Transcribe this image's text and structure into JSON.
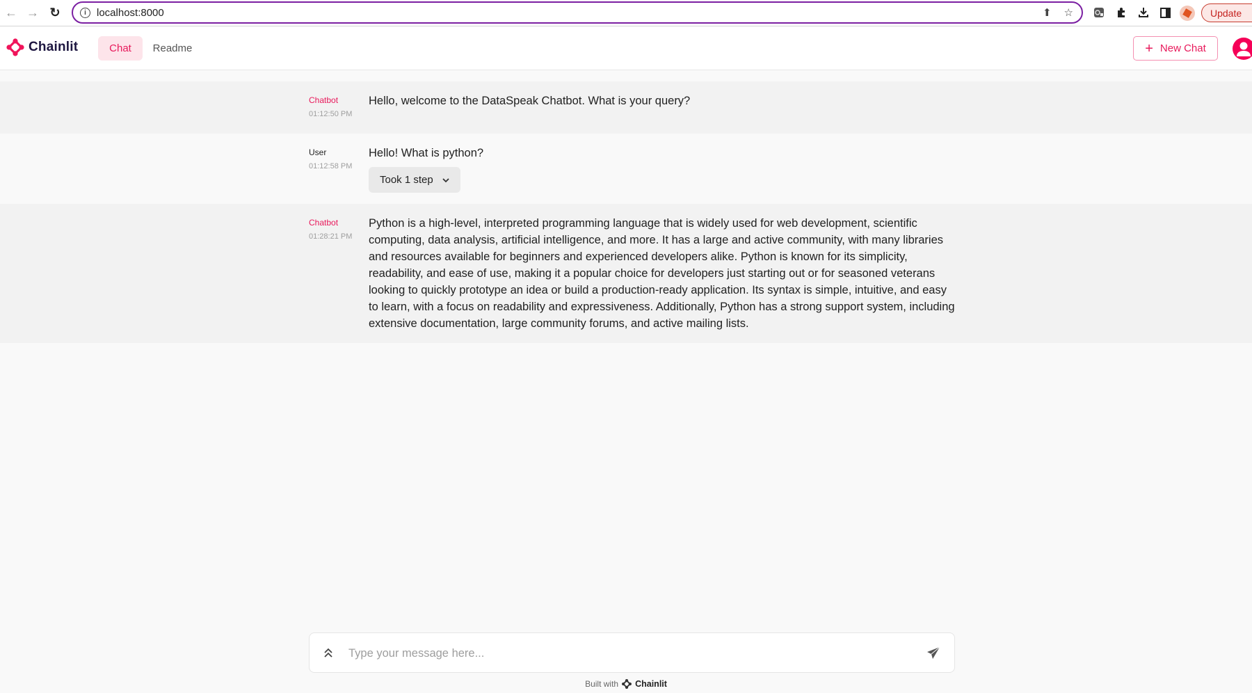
{
  "browser": {
    "url": "localhost:8000",
    "update_label": "Update",
    "icons": [
      "back-arrow-icon",
      "forward-arrow-icon",
      "reload-icon",
      "site-info-icon",
      "share-icon",
      "bookmark-star-icon",
      "extension-icon",
      "puzzle-icon",
      "download-icon",
      "sidebar-icon",
      "profile-icon"
    ]
  },
  "header": {
    "brand": "Chainlit",
    "tabs": [
      {
        "label": "Chat",
        "active": true
      },
      {
        "label": "Readme",
        "active": false
      }
    ],
    "new_chat_label": "New Chat",
    "accent_color": "#e8195b"
  },
  "messages": [
    {
      "author": "Chatbot",
      "role": "bot",
      "time": "01:12:50 PM",
      "content": "Hello, welcome to the DataSpeak Chatbot. What is your query?"
    },
    {
      "author": "User",
      "role": "user",
      "time": "01:12:58 PM",
      "content": "Hello! What is python?",
      "steps_label": "Took 1 step"
    },
    {
      "author": "Chatbot",
      "role": "bot",
      "time": "01:28:21 PM",
      "content": "Python is a high-level, interpreted programming language that is widely used for web development, scientific computing, data analysis, artificial intelligence, and more. It has a large and active community, with many libraries and resources available for beginners and experienced developers alike. Python is known for its simplicity, readability, and ease of use, making it a popular choice for developers just starting out or for seasoned veterans looking to quickly prototype an idea or build a production-ready application. Its syntax is simple, intuitive, and easy to learn, with a focus on readability and expressiveness. Additionally, Python has a strong support system, including extensive documentation, large community forums, and active mailing lists."
    }
  ],
  "composer": {
    "placeholder": "Type your message here...",
    "value": ""
  },
  "footer": {
    "built_with": "Built with",
    "brand": "Chainlit"
  }
}
